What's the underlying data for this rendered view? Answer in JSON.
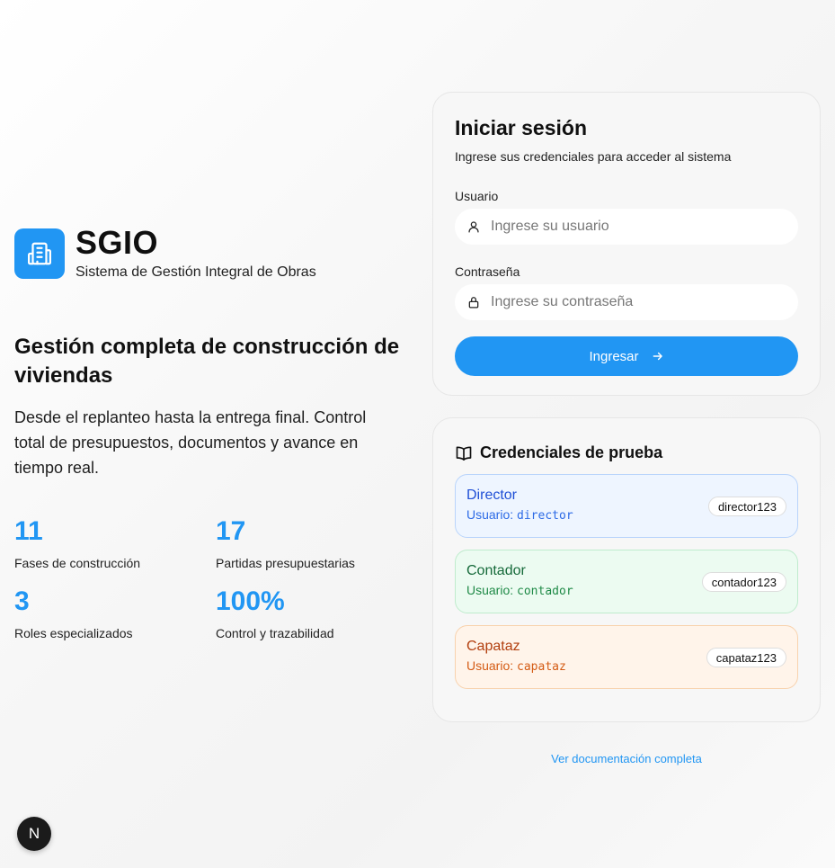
{
  "brand": {
    "title": "SGIO",
    "subtitle": "Sistema de Gestión Integral de Obras",
    "logo_icon": "building-icon",
    "color": "#2196f3"
  },
  "hero": {
    "headline": "Gestión completa de construcción de viviendas",
    "description": "Desde el replanteo hasta la entrega final. Control total de presupuestos, documentos y avance en tiempo real."
  },
  "stats": [
    {
      "value": "11",
      "label": "Fases de construcción"
    },
    {
      "value": "17",
      "label": "Partidas presupuestarias"
    },
    {
      "value": "3",
      "label": "Roles especializados"
    },
    {
      "value": "100%",
      "label": "Control y trazabilidad"
    }
  ],
  "login": {
    "title": "Iniciar sesión",
    "subtitle": "Ingrese sus credenciales para acceder al sistema",
    "username_label": "Usuario",
    "username_placeholder": "Ingrese su usuario",
    "username_value": "",
    "password_label": "Contraseña",
    "password_placeholder": "Ingrese su contraseña",
    "password_value": "",
    "submit_label": "Ingresar",
    "submit_icon": "arrow-right-icon"
  },
  "credentials": {
    "title": "Credenciales de prueba",
    "icon": "book-open-icon",
    "items": [
      {
        "role": "Director",
        "user_prefix": "Usuario: ",
        "username": "director",
        "password": "director123",
        "color": "#1f4fd6"
      },
      {
        "role": "Contador",
        "user_prefix": "Usuario: ",
        "username": "contador",
        "password": "contador123",
        "color": "#166a3a"
      },
      {
        "role": "Capataz",
        "user_prefix": "Usuario: ",
        "username": "capataz",
        "password": "capataz123",
        "color": "#b23f0f"
      }
    ]
  },
  "doc_link": "Ver documentación completa",
  "dev_badge": "N"
}
